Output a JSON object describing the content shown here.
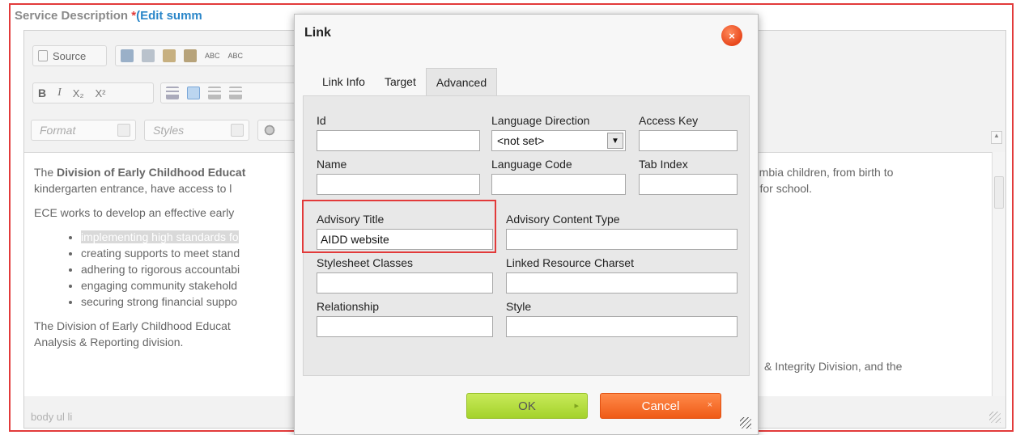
{
  "page": {
    "heading": "Service Description ",
    "required_mark": "*",
    "edit_summary": "(Edit summ"
  },
  "toolbar": {
    "source_label": "Source",
    "bold": "B",
    "italic": "I",
    "subscript": "X₂",
    "superscript": "X²",
    "spell1": "ABC",
    "spell2": "ABC",
    "format_placeholder": "Format",
    "styles_placeholder": "Styles"
  },
  "editor": {
    "para1_prefix": "The ",
    "para1_bold": "Division of Early Childhood Educat",
    "para1_right": "olumbia children, from birth to",
    "para1_line2": "kindergarten entrance, have access to l",
    "para1_line2_right": "ed for school.",
    "para2": "ECE works to develop an effective early",
    "bullets": [
      "implementing high standards fo",
      "creating supports to meet stand",
      "adhering to rigorous accountabi",
      "engaging community stakehold",
      "securing strong financial suppo"
    ],
    "para3_line1": "The Division of Early Childhood Educat",
    "para3_right": "& Integrity Division, and the",
    "para3_line2": "Analysis & Reporting division.",
    "status_path": "body  ul  li"
  },
  "dialog": {
    "title": "Link",
    "close_glyph": "×",
    "tabs": [
      {
        "label": "Link Info"
      },
      {
        "label": "Target"
      },
      {
        "label": "Advanced"
      }
    ],
    "fields": {
      "id": {
        "label": "Id",
        "value": ""
      },
      "language_direction": {
        "label": "Language Direction",
        "value": "<not set>"
      },
      "access_key": {
        "label": "Access Key",
        "value": ""
      },
      "name": {
        "label": "Name",
        "value": ""
      },
      "language_code": {
        "label": "Language Code",
        "value": ""
      },
      "tab_index": {
        "label": "Tab Index",
        "value": ""
      },
      "advisory_title": {
        "label": "Advisory Title",
        "value": "AIDD website"
      },
      "advisory_content_type": {
        "label": "Advisory Content Type",
        "value": ""
      },
      "stylesheet_classes": {
        "label": "Stylesheet Classes",
        "value": ""
      },
      "linked_resource_charset": {
        "label": "Linked Resource Charset",
        "value": ""
      },
      "relationship": {
        "label": "Relationship",
        "value": ""
      },
      "style": {
        "label": "Style",
        "value": ""
      }
    },
    "ok_label": "OK",
    "ok_icon": "▸",
    "cancel_label": "Cancel",
    "cancel_icon": "×"
  },
  "colors": {
    "highlight": "#e23a3a",
    "ok_green": "#a4d22b",
    "cancel_orange": "#ef5a16",
    "link_blue": "#2a86c9"
  }
}
